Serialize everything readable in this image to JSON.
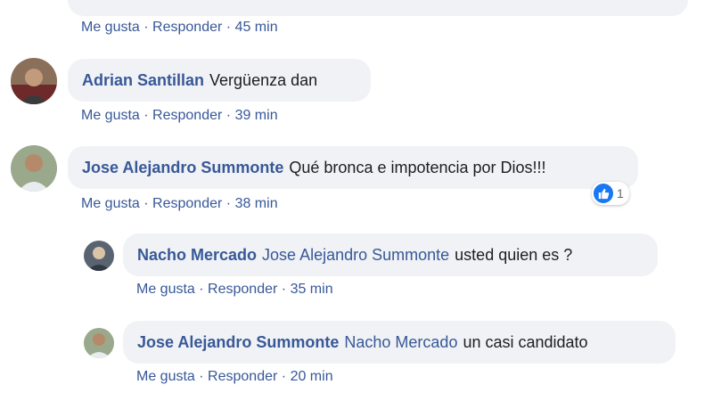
{
  "comments": [
    {
      "actions": {
        "like": "Me gusta",
        "reply": "Responder",
        "time": "45 min"
      }
    },
    {
      "author": "Adrian Santillan",
      "text": "Vergüenza dan",
      "actions": {
        "like": "Me gusta",
        "reply": "Responder",
        "time": "39 min"
      }
    },
    {
      "author": "Jose Alejandro Summonte",
      "text": "Qué bronca e impotencia por Dios!!!",
      "reaction_count": "1",
      "actions": {
        "like": "Me gusta",
        "reply": "Responder",
        "time": "38 min"
      }
    }
  ],
  "replies": [
    {
      "author": "Nacho Mercado",
      "mention": "Jose Alejandro Summonte",
      "text": "usted quien es ?",
      "actions": {
        "like": "Me gusta",
        "reply": "Responder",
        "time": "35 min"
      }
    },
    {
      "author": "Jose Alejandro Summonte",
      "mention": "Nacho Mercado",
      "text": "un casi candidato",
      "actions": {
        "like": "Me gusta",
        "reply": "Responder",
        "time": "20 min"
      }
    }
  ],
  "separator": "·",
  "colors": {
    "link": "#385898",
    "bubble": "#f0f2f5",
    "text": "#1c1e21",
    "like": "#1877f2"
  }
}
